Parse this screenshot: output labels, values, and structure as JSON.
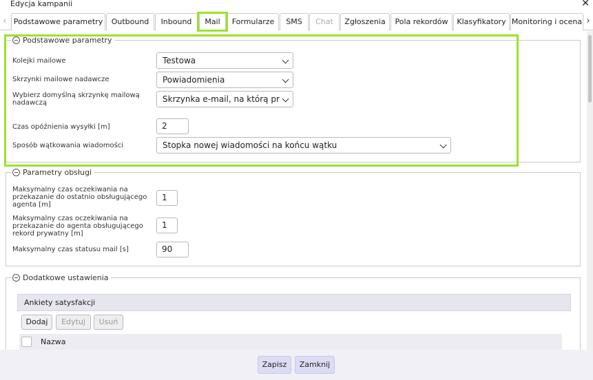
{
  "window": {
    "title": "Edycja kampanii",
    "close_glyph": "✕"
  },
  "tabs": [
    {
      "label": "Podstawowe parametry",
      "disabled": false
    },
    {
      "label": "Outbound",
      "disabled": false
    },
    {
      "label": "Inbound",
      "disabled": false
    },
    {
      "label": "Mail",
      "disabled": false,
      "active": true
    },
    {
      "label": "Formularze",
      "disabled": false
    },
    {
      "label": "SMS",
      "disabled": false
    },
    {
      "label": "Chat",
      "disabled": true
    },
    {
      "label": "Zgłoszenia",
      "disabled": false
    },
    {
      "label": "Pola rekordów",
      "disabled": false
    },
    {
      "label": "Klasyfikatory",
      "disabled": false
    },
    {
      "label": "Monitoring i ocena",
      "disabled": false
    }
  ],
  "tab_arrows": {
    "left": "‹",
    "right": "›"
  },
  "basic": {
    "legend": "Podstawowe parametry",
    "queues_label": "Kolejki mailowe",
    "queues_value": "Testowa",
    "senders_label": "Skrzynki mailowe nadawcze",
    "senders_value": "Powiadomienia",
    "default_sender_label_1": "Wybierz domyślną skrzynkę mailową",
    "default_sender_label_2": "nadawczą",
    "default_sender_value": "Skrzynka e-mail,  na którą pr",
    "delay_label": "Czas opóźnienia wysyłki [m]",
    "delay_value": "2",
    "threading_label": "Sposób wątkowania wiadomości",
    "threading_value": "Stopka nowej wiadomości na końcu wątku"
  },
  "handling": {
    "legend": "Parametry obsługi",
    "last_agent_label_1": "Maksymalny czas oczekiwania na",
    "last_agent_label_2": "przekazanie do ostatnio obsługującego",
    "last_agent_label_3": "agenta [m]",
    "last_agent_value": "1",
    "private_label_1": "Maksymalny czas oczekiwania na",
    "private_label_2": "przekazanie do agenta obsługującego",
    "private_label_3": "rekord prywatny [m]",
    "private_value": "1",
    "status_label": "Maksymalny czas statusu mail [s]",
    "status_value": "90"
  },
  "extra": {
    "legend": "Dodatkowe ustawienia",
    "surveys_title": "Ankiety satysfakcji",
    "add_label": "Dodaj",
    "edit_label": "Edytuj",
    "delete_label": "Usuń",
    "column_name": "Nazwa"
  },
  "footer": {
    "save_label": "Zapisz",
    "close_label": "Zamknij"
  },
  "colors": {
    "highlight": "#9be22a",
    "footer_button": "#dcdcf4",
    "panel_header": "#e6e6ef"
  }
}
